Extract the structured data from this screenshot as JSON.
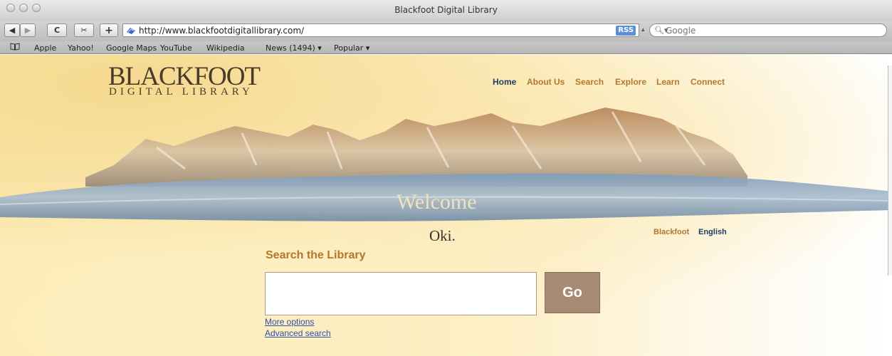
{
  "window": {
    "title": "Blackfoot Digital Library"
  },
  "toolbar": {
    "back_label": "◀",
    "forward_label": "▶",
    "reload_label": "C",
    "snapback_label": "✂",
    "add_label": "+",
    "url": "http://www.blackfootdigitallibrary.com/",
    "rss_label": "RSS",
    "search_placeholder": "Google"
  },
  "bookmarks": {
    "items": [
      {
        "label": "Apple"
      },
      {
        "label": "Yahoo!"
      },
      {
        "label": "Google Maps"
      },
      {
        "label": "YouTube"
      },
      {
        "label": "Wikipedia"
      },
      {
        "label": "News (1494) ▾"
      },
      {
        "label": "Popular ▾"
      }
    ]
  },
  "site": {
    "logo_title": "BLACKFOOT",
    "logo_subtitle": "DIGITAL LIBRARY",
    "nav": [
      {
        "label": "Home",
        "active": true
      },
      {
        "label": "About Us"
      },
      {
        "label": "Search"
      },
      {
        "label": "Explore"
      },
      {
        "label": "Learn"
      },
      {
        "label": "Connect"
      }
    ],
    "welcome": "Welcome",
    "greeting": "Oki.",
    "language": {
      "blackfoot": "Blackfoot",
      "english": "English"
    },
    "search": {
      "heading": "Search the Library",
      "input_value": "",
      "button_label": "Go",
      "more_options": "More options",
      "advanced_search": "Advanced search"
    }
  },
  "colors": {
    "accent_gold": "#b5762e",
    "nav_active": "#1f3d66",
    "go_button": "#a68a73",
    "link_blue": "#2f50a8"
  }
}
